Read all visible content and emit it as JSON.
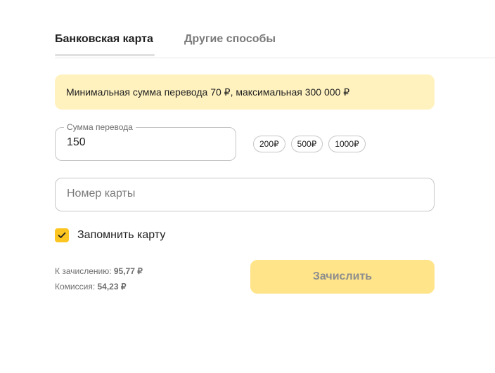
{
  "tabs": [
    {
      "label": "Банковская карта",
      "active": true
    },
    {
      "label": "Другие способы",
      "active": false
    }
  ],
  "banner": {
    "text": "Минимальная сумма перевода 70 ₽, максимальная 300 000 ₽"
  },
  "amount": {
    "label": "Сумма перевода",
    "value": "150"
  },
  "quick_amounts": [
    "200₽",
    "500₽",
    "1000₽"
  ],
  "card_number": {
    "placeholder": "Номер карты",
    "value": ""
  },
  "remember": {
    "label": "Запомнить карту",
    "checked": true,
    "icon": "checkmark-icon"
  },
  "summary": {
    "credit_label": "К зачислению:",
    "credit_value": "95,77 ₽",
    "fee_label": "Комиссия:",
    "fee_value": "54,23 ₽"
  },
  "submit": {
    "label": "Зачислить"
  },
  "colors": {
    "accent": "#fcc521",
    "banner_bg": "#fff2bf",
    "button_bg_disabled": "#ffe48a"
  }
}
